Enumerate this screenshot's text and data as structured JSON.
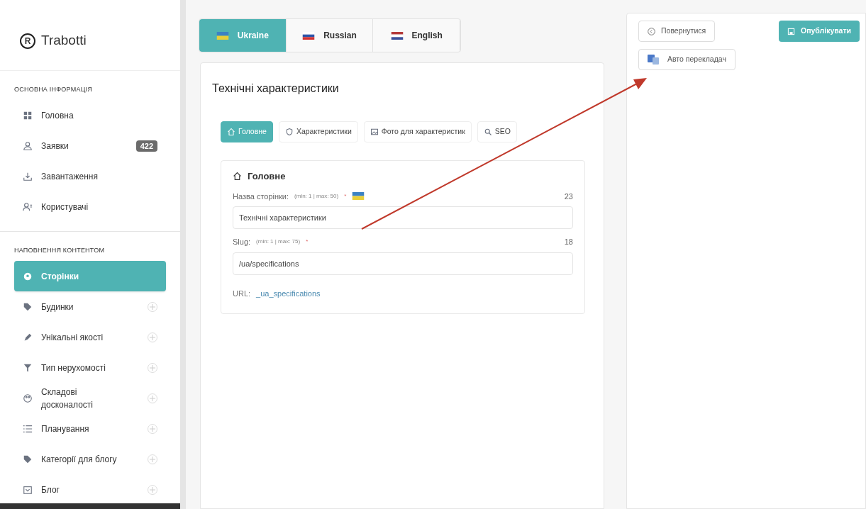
{
  "sidebar": {
    "logo": "Trabotti",
    "logo_mark": "R",
    "sections": [
      {
        "title": "ОСНОВНА ІНФОРМАЦІЯ",
        "items": [
          {
            "label": "Головна",
            "selected": false,
            "add_button": false
          },
          {
            "label": "Заявки",
            "badge": "422",
            "selected": false,
            "add_button": false
          },
          {
            "label": "Завантаження",
            "selected": false,
            "add_button": false
          },
          {
            "label": "Користувачі",
            "selected": false,
            "add_button": false
          }
        ]
      },
      {
        "title": "НАПОВНЕННЯ КОНТЕНТОМ",
        "items": [
          {
            "label": "Сторінки",
            "selected": true,
            "add_button": false
          },
          {
            "label": "Будинки",
            "selected": false,
            "add_button": true
          },
          {
            "label": "Унікальні якості",
            "selected": false,
            "add_button": true
          },
          {
            "label": "Тип нерухомості",
            "selected": false,
            "add_button": true
          },
          {
            "label": "Складові досконалості",
            "selected": false,
            "add_button": true
          },
          {
            "label": "Планування",
            "selected": false,
            "add_button": true
          },
          {
            "label": "Категорії для блогу",
            "selected": false,
            "add_button": true
          },
          {
            "label": "Блог",
            "selected": false,
            "add_button": true
          }
        ]
      }
    ]
  },
  "language_tabs": [
    {
      "label": "Ukraine",
      "selected": true
    },
    {
      "label": "Russian",
      "selected": false
    },
    {
      "label": "English",
      "selected": false
    }
  ],
  "card": {
    "title": "Технічні характеристики",
    "tabs": [
      {
        "label": "Головне",
        "selected": true
      },
      {
        "label": "Характеристики",
        "selected": false
      },
      {
        "label": "Фото для характеристик",
        "selected": false
      },
      {
        "label": "SEO",
        "selected": false
      }
    ],
    "section": {
      "title": "Головне",
      "fields": [
        {
          "label": "Назва сторінки:",
          "hint": "(min: 1 | max: 50)",
          "required_mark": "*",
          "flag": true,
          "count": "23",
          "value": "Технічні характеристики"
        },
        {
          "label": "Slug:",
          "hint": "(min: 1 | max: 75)",
          "required_mark": "*",
          "flag": false,
          "count": "18",
          "value": "/ua/specifications"
        }
      ],
      "url_label": "URL:",
      "url_value": "_ua_specifications"
    }
  },
  "actions": {
    "back": "Повернутися",
    "publish": "Опублікувати",
    "translate": "Авто перекладач"
  }
}
